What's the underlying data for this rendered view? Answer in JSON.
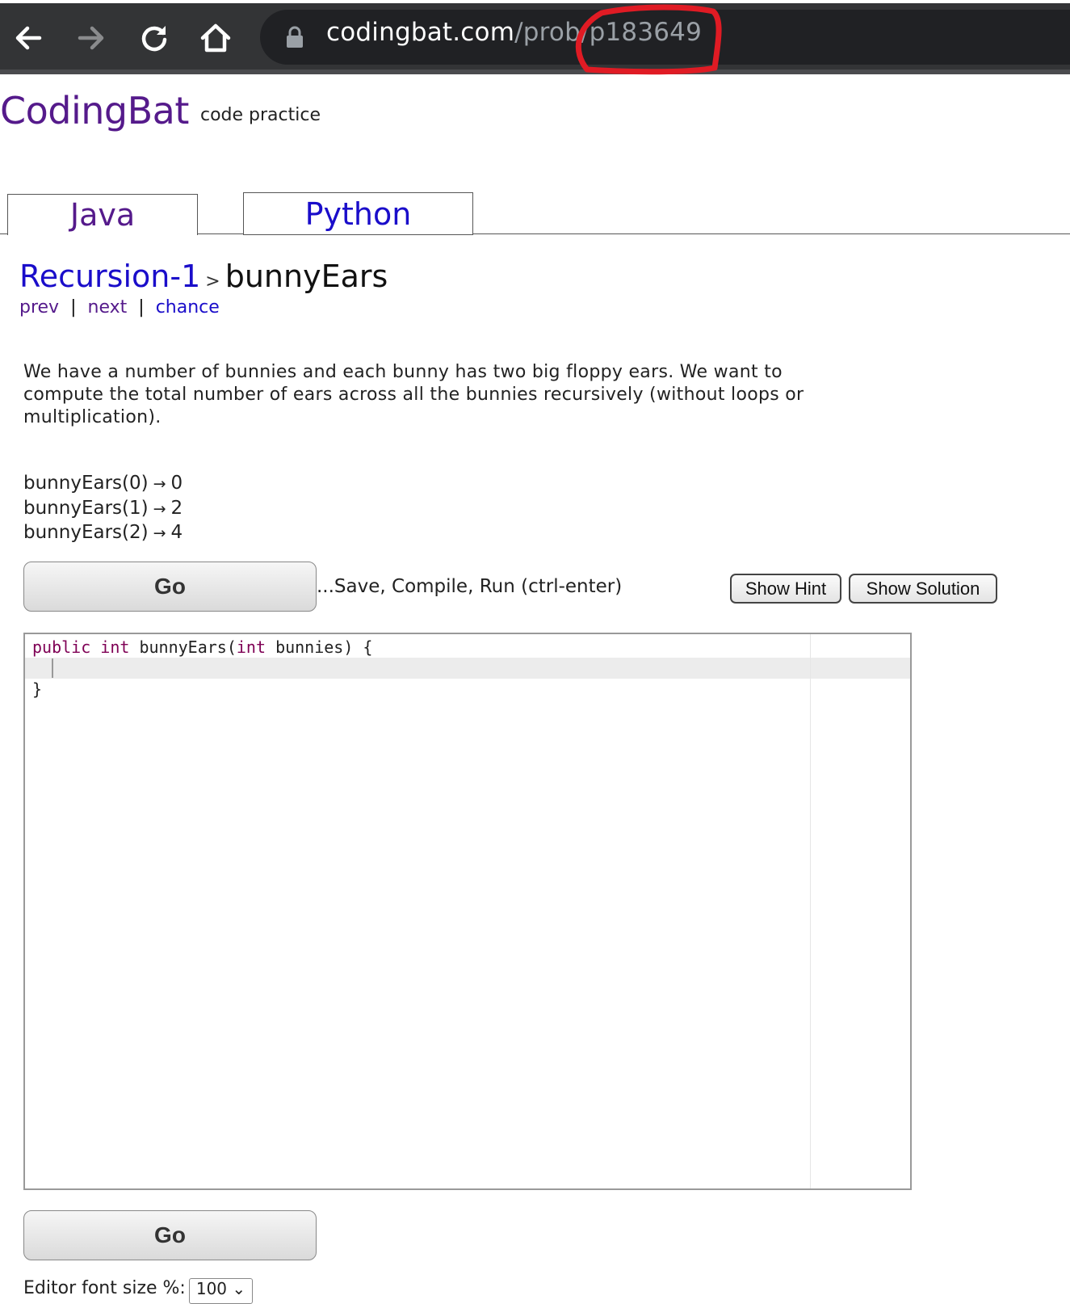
{
  "browser": {
    "url_host": "codingbat.com",
    "url_path": "/prob/p183649",
    "annotation_color": "#e01b24"
  },
  "header": {
    "logo": "CodingBat",
    "tagline": "code practice"
  },
  "tabs": [
    {
      "label": "Java",
      "active": true
    },
    {
      "label": "Python",
      "active": false
    }
  ],
  "breadcrumb": {
    "section": "Recursion-1",
    "separator": ">",
    "problem": "bunnyEars"
  },
  "nav_links": [
    "prev",
    "next",
    "chance"
  ],
  "description": "We have a number of bunnies and each bunny has two big floppy ears. We want to compute the total number of ears across all the bunnies recursively (without loops or multiplication).",
  "examples": [
    {
      "call": "bunnyEars(0)",
      "arrow": "→",
      "result": "0"
    },
    {
      "call": "bunnyEars(1)",
      "arrow": "→",
      "result": "2"
    },
    {
      "call": "bunnyEars(2)",
      "arrow": "→",
      "result": "4"
    }
  ],
  "actions": {
    "go_label": "Go",
    "save_text": "...Save, Compile, Run (ctrl-enter)",
    "hint_label": "Show Hint",
    "solution_label": "Show Solution"
  },
  "editor": {
    "line1_kw1": "public",
    "line1_kw2": "int",
    "line1_name": "bunnyEars(",
    "line1_kw3": "int",
    "line1_rest": "bunnies) {",
    "line2": "",
    "line3": "}"
  },
  "font_size": {
    "label": "Editor font size %:",
    "value": "100",
    "chevron": "⌄"
  }
}
